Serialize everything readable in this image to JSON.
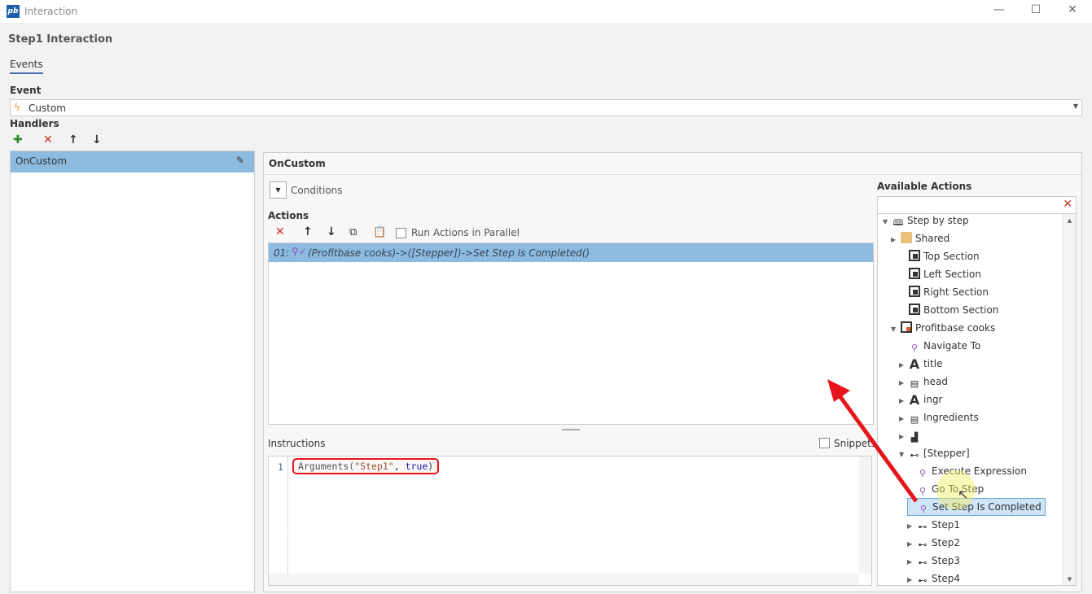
{
  "window": {
    "title": "Interaction",
    "minimize": "—",
    "maximize": "☐",
    "close": "✕",
    "logo": "pb"
  },
  "dialog_title": "Step1 Interaction",
  "tabs": [
    {
      "label": "Events",
      "active": true
    }
  ],
  "event": {
    "label": "Event",
    "value": "Custom"
  },
  "handlers": {
    "label": "Handlers",
    "items": [
      {
        "label": "OnCustom",
        "selected": true
      }
    ]
  },
  "handler_panel": {
    "title": "OnCustom",
    "conditions_label": "Conditions",
    "actions_label": "Actions",
    "run_parallel_label": "Run Actions in Parallel",
    "run_parallel_checked": false,
    "actions": [
      {
        "index": "01:",
        "text": "(Profitbase cooks)->([Stepper])->Set Step Is Completed()",
        "selected": true
      }
    ],
    "instructions_label": "Instructions",
    "snippets_label": "Snippets",
    "code": {
      "line_number": "1",
      "fn": "Arguments(",
      "str": "\"Step1\"",
      "sep": ", ",
      "kw": "true",
      "close": ")"
    }
  },
  "available_actions": {
    "label": "Available Actions",
    "search_value": "",
    "tree": [
      {
        "label": "Step by step",
        "icon": "book-icon",
        "expanded": true
      },
      {
        "label": "Shared",
        "icon": "folder-icon",
        "expanded": false
      },
      {
        "label": "Top Section",
        "icon": "section-icon"
      },
      {
        "label": "Left Section",
        "icon": "section-icon"
      },
      {
        "label": "Right Section",
        "icon": "section-icon"
      },
      {
        "label": "Bottom Section",
        "icon": "section-icon"
      },
      {
        "label": "Profitbase cooks",
        "icon": "page-icon",
        "expanded": true
      },
      {
        "label": "Navigate To",
        "icon": "action-icon"
      },
      {
        "label": "title",
        "icon": "text-icon",
        "expanded": false
      },
      {
        "label": "head",
        "icon": "list-icon",
        "expanded": false
      },
      {
        "label": "ingr",
        "icon": "text-icon",
        "expanded": false
      },
      {
        "label": "Ingredients",
        "icon": "list-icon",
        "expanded": false
      },
      {
        "label": "",
        "icon": "image-icon",
        "expanded": false
      },
      {
        "label": "[Stepper]",
        "icon": "stepper-icon",
        "expanded": true
      },
      {
        "label": "Execute Expression",
        "icon": "action-icon"
      },
      {
        "label": "Go To Step",
        "icon": "action-icon"
      },
      {
        "label": "Set Step Is Completed",
        "icon": "action-check-icon",
        "selected": true
      },
      {
        "label": "Step1",
        "icon": "stepper-icon",
        "expanded": false
      },
      {
        "label": "Step2",
        "icon": "stepper-icon",
        "expanded": false
      },
      {
        "label": "Step3",
        "icon": "stepper-icon",
        "expanded": false
      },
      {
        "label": "Step4",
        "icon": "stepper-icon",
        "expanded": false
      }
    ]
  },
  "colors": {
    "selection": "#8dbbe0",
    "accent": "#1e5fa8",
    "annotation": "#e8141b"
  }
}
